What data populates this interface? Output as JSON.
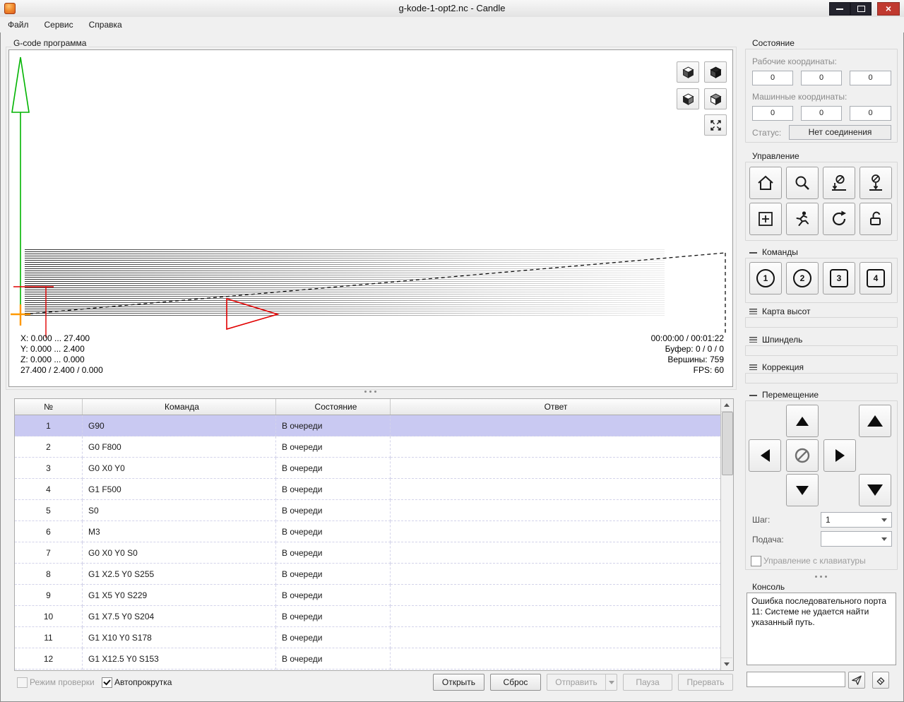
{
  "colors": {
    "background": "#f0f0f0",
    "selection": "#c9c9f2",
    "close_button": "#c0392f",
    "axis_green": "#00b400",
    "tool_red": "#e10000",
    "origin_orange": "#ff9900"
  },
  "icons": {
    "app-icon": "candle-flame",
    "minimize-icon": "minus-bar",
    "maximize-icon": "square",
    "close-icon": "x",
    "view-cube-icons": "isometric-cube",
    "fit-view-icon": "expand-arrows",
    "home-icon": "house",
    "probe-icon": "magnifier",
    "zero-xy-icon": "slashed-zero-down-arrow",
    "zero-z-icon": "slashed-zero-down-arrow",
    "origin-icon": "square-plus",
    "safe-position-icon": "running-man",
    "reset-icon": "circular-arrow",
    "unlock-icon": "open-padlock",
    "jog-icons": "triangles",
    "jog-stop-icon": "circle-slash",
    "send-icon": "paper-plane",
    "clear-icon": "eraser"
  },
  "window": {
    "title": "g-kode-1-opt2.nc - Candle"
  },
  "menu": {
    "items": [
      {
        "label": "Файл"
      },
      {
        "label": "Сервис"
      },
      {
        "label": "Справка"
      }
    ]
  },
  "viz": {
    "group_title": "G-code программа",
    "stats_left": [
      "X: 0.000 ... 27.400",
      "Y: 0.000 ... 2.400",
      "Z: 0.000 ... 0.000",
      "27.400 / 2.400 / 0.000"
    ],
    "stats_right": [
      "00:00:00 / 00:01:22",
      "Буфер: 0 / 0 / 0",
      "Вершины: 759",
      "FPS: 60"
    ]
  },
  "table": {
    "headers": [
      "№",
      "Команда",
      "Состояние",
      "Ответ"
    ],
    "rows": [
      {
        "n": "1",
        "cmd": "G90",
        "state": "В очереди",
        "resp": ""
      },
      {
        "n": "2",
        "cmd": "G0 F800",
        "state": "В очереди",
        "resp": ""
      },
      {
        "n": "3",
        "cmd": "G0 X0 Y0",
        "state": "В очереди",
        "resp": ""
      },
      {
        "n": "4",
        "cmd": "G1 F500",
        "state": "В очереди",
        "resp": ""
      },
      {
        "n": "5",
        "cmd": "S0",
        "state": "В очереди",
        "resp": ""
      },
      {
        "n": "6",
        "cmd": "M3",
        "state": "В очереди",
        "resp": ""
      },
      {
        "n": "7",
        "cmd": "G0 X0 Y0 S0",
        "state": "В очереди",
        "resp": ""
      },
      {
        "n": "8",
        "cmd": "G1 X2.5 Y0 S255",
        "state": "В очереди",
        "resp": ""
      },
      {
        "n": "9",
        "cmd": "G1 X5 Y0 S229",
        "state": "В очереди",
        "resp": ""
      },
      {
        "n": "10",
        "cmd": "G1 X7.5 Y0 S204",
        "state": "В очереди",
        "resp": ""
      },
      {
        "n": "11",
        "cmd": "G1 X10 Y0 S178",
        "state": "В очереди",
        "resp": ""
      },
      {
        "n": "12",
        "cmd": "G1 X12.5 Y0 S153",
        "state": "В очереди",
        "resp": ""
      }
    ]
  },
  "bottom_bar": {
    "check_mode": "Режим проверки",
    "check_autoscroll": "Автопрокрутка",
    "open": "Открыть",
    "reset": "Сброс",
    "send": "Отправить",
    "pause": "Пауза",
    "abort": "Прервать"
  },
  "state_panel": {
    "title": "Состояние",
    "work_coords_label": "Рабочие координаты:",
    "machine_coords_label": "Машинные координаты:",
    "work_coords": [
      "0",
      "0",
      "0"
    ],
    "machine_coords": [
      "0",
      "0",
      "0"
    ],
    "status_label": "Статус:",
    "status_value": "Нет соединения"
  },
  "control_panel": {
    "title": "Управление"
  },
  "commands_panel": {
    "title": "Команды",
    "buttons": [
      "1",
      "2",
      "3",
      "4"
    ]
  },
  "heightmap_panel": {
    "title": "Карта высот"
  },
  "spindle_panel": {
    "title": "Шпиндель"
  },
  "correction_panel": {
    "title": "Коррекция"
  },
  "jog_panel": {
    "title": "Перемещение",
    "step_label": "Шаг:",
    "step_value": "1",
    "feed_label": "Подача:",
    "feed_value": "",
    "keyboard_checkbox": "Управление с клавиатуры"
  },
  "console_panel": {
    "title": "Консоль",
    "output": "Ошибка последовательного порта 11: Системе не удается найти указанный путь.",
    "input_value": ""
  }
}
